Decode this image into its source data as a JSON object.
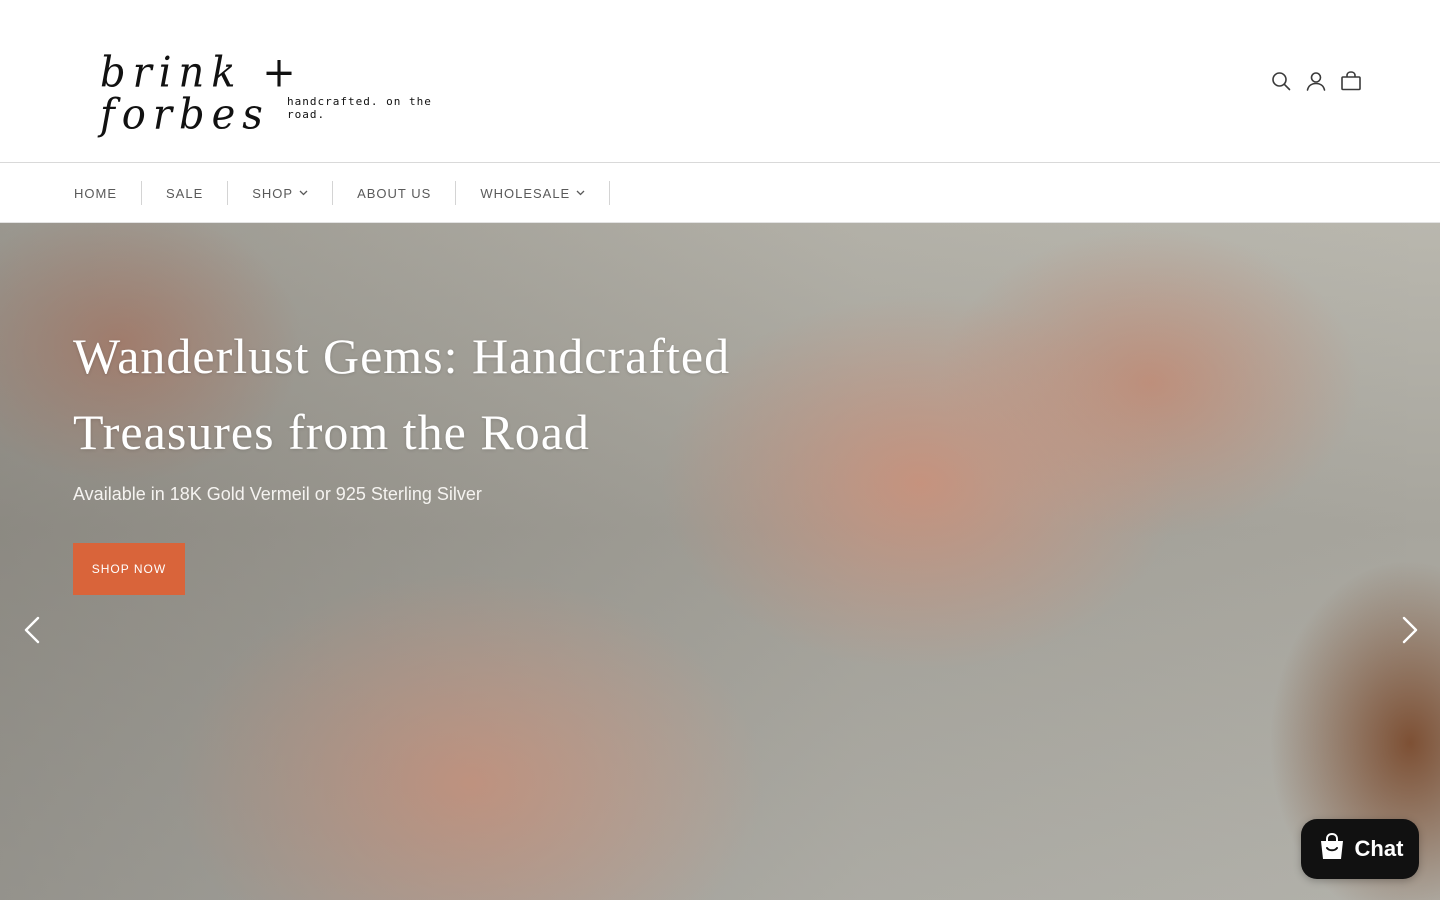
{
  "brand": {
    "logo_word": "brink + forbes",
    "tagline": "handcrafted. on the road."
  },
  "header": {
    "icons": [
      "search-icon",
      "account-icon",
      "cart-icon"
    ]
  },
  "nav": {
    "items": [
      {
        "label": "HOME",
        "dropdown": false
      },
      {
        "label": "SALE",
        "dropdown": false
      },
      {
        "label": "SHOP",
        "dropdown": true
      },
      {
        "label": "ABOUT US",
        "dropdown": false
      },
      {
        "label": "WHOLESALE",
        "dropdown": true
      }
    ]
  },
  "hero": {
    "title_line1": "Wanderlust Gems: Handcrafted",
    "title_line2": "Treasures from the Road",
    "subtitle": "Available in 18K Gold Vermeil or 925 Sterling Silver",
    "cta_label": "SHOP NOW",
    "arrows": [
      "chevron-left-icon",
      "chevron-right-icon"
    ]
  },
  "chat": {
    "label": "Chat"
  },
  "colors": {
    "accent": "#d9643a",
    "chat_bg": "#111111",
    "nav_text": "#5a5a5a"
  }
}
